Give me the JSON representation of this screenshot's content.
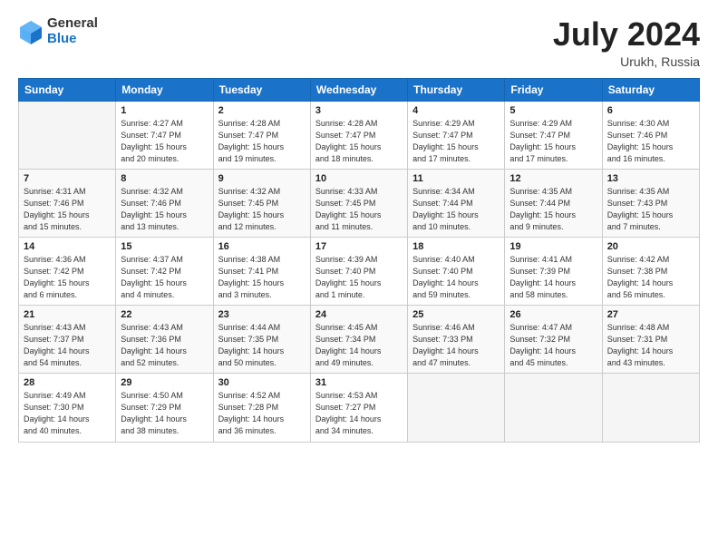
{
  "header": {
    "logo_general": "General",
    "logo_blue": "Blue",
    "month_year": "July 2024",
    "location": "Urukh, Russia"
  },
  "days_of_week": [
    "Sunday",
    "Monday",
    "Tuesday",
    "Wednesday",
    "Thursday",
    "Friday",
    "Saturday"
  ],
  "weeks": [
    [
      {
        "day": "",
        "detail": ""
      },
      {
        "day": "1",
        "detail": "Sunrise: 4:27 AM\nSunset: 7:47 PM\nDaylight: 15 hours\nand 20 minutes."
      },
      {
        "day": "2",
        "detail": "Sunrise: 4:28 AM\nSunset: 7:47 PM\nDaylight: 15 hours\nand 19 minutes."
      },
      {
        "day": "3",
        "detail": "Sunrise: 4:28 AM\nSunset: 7:47 PM\nDaylight: 15 hours\nand 18 minutes."
      },
      {
        "day": "4",
        "detail": "Sunrise: 4:29 AM\nSunset: 7:47 PM\nDaylight: 15 hours\nand 17 minutes."
      },
      {
        "day": "5",
        "detail": "Sunrise: 4:29 AM\nSunset: 7:47 PM\nDaylight: 15 hours\nand 17 minutes."
      },
      {
        "day": "6",
        "detail": "Sunrise: 4:30 AM\nSunset: 7:46 PM\nDaylight: 15 hours\nand 16 minutes."
      }
    ],
    [
      {
        "day": "7",
        "detail": "Sunrise: 4:31 AM\nSunset: 7:46 PM\nDaylight: 15 hours\nand 15 minutes."
      },
      {
        "day": "8",
        "detail": "Sunrise: 4:32 AM\nSunset: 7:46 PM\nDaylight: 15 hours\nand 13 minutes."
      },
      {
        "day": "9",
        "detail": "Sunrise: 4:32 AM\nSunset: 7:45 PM\nDaylight: 15 hours\nand 12 minutes."
      },
      {
        "day": "10",
        "detail": "Sunrise: 4:33 AM\nSunset: 7:45 PM\nDaylight: 15 hours\nand 11 minutes."
      },
      {
        "day": "11",
        "detail": "Sunrise: 4:34 AM\nSunset: 7:44 PM\nDaylight: 15 hours\nand 10 minutes."
      },
      {
        "day": "12",
        "detail": "Sunrise: 4:35 AM\nSunset: 7:44 PM\nDaylight: 15 hours\nand 9 minutes."
      },
      {
        "day": "13",
        "detail": "Sunrise: 4:35 AM\nSunset: 7:43 PM\nDaylight: 15 hours\nand 7 minutes."
      }
    ],
    [
      {
        "day": "14",
        "detail": "Sunrise: 4:36 AM\nSunset: 7:42 PM\nDaylight: 15 hours\nand 6 minutes."
      },
      {
        "day": "15",
        "detail": "Sunrise: 4:37 AM\nSunset: 7:42 PM\nDaylight: 15 hours\nand 4 minutes."
      },
      {
        "day": "16",
        "detail": "Sunrise: 4:38 AM\nSunset: 7:41 PM\nDaylight: 15 hours\nand 3 minutes."
      },
      {
        "day": "17",
        "detail": "Sunrise: 4:39 AM\nSunset: 7:40 PM\nDaylight: 15 hours\nand 1 minute."
      },
      {
        "day": "18",
        "detail": "Sunrise: 4:40 AM\nSunset: 7:40 PM\nDaylight: 14 hours\nand 59 minutes."
      },
      {
        "day": "19",
        "detail": "Sunrise: 4:41 AM\nSunset: 7:39 PM\nDaylight: 14 hours\nand 58 minutes."
      },
      {
        "day": "20",
        "detail": "Sunrise: 4:42 AM\nSunset: 7:38 PM\nDaylight: 14 hours\nand 56 minutes."
      }
    ],
    [
      {
        "day": "21",
        "detail": "Sunrise: 4:43 AM\nSunset: 7:37 PM\nDaylight: 14 hours\nand 54 minutes."
      },
      {
        "day": "22",
        "detail": "Sunrise: 4:43 AM\nSunset: 7:36 PM\nDaylight: 14 hours\nand 52 minutes."
      },
      {
        "day": "23",
        "detail": "Sunrise: 4:44 AM\nSunset: 7:35 PM\nDaylight: 14 hours\nand 50 minutes."
      },
      {
        "day": "24",
        "detail": "Sunrise: 4:45 AM\nSunset: 7:34 PM\nDaylight: 14 hours\nand 49 minutes."
      },
      {
        "day": "25",
        "detail": "Sunrise: 4:46 AM\nSunset: 7:33 PM\nDaylight: 14 hours\nand 47 minutes."
      },
      {
        "day": "26",
        "detail": "Sunrise: 4:47 AM\nSunset: 7:32 PM\nDaylight: 14 hours\nand 45 minutes."
      },
      {
        "day": "27",
        "detail": "Sunrise: 4:48 AM\nSunset: 7:31 PM\nDaylight: 14 hours\nand 43 minutes."
      }
    ],
    [
      {
        "day": "28",
        "detail": "Sunrise: 4:49 AM\nSunset: 7:30 PM\nDaylight: 14 hours\nand 40 minutes."
      },
      {
        "day": "29",
        "detail": "Sunrise: 4:50 AM\nSunset: 7:29 PM\nDaylight: 14 hours\nand 38 minutes."
      },
      {
        "day": "30",
        "detail": "Sunrise: 4:52 AM\nSunset: 7:28 PM\nDaylight: 14 hours\nand 36 minutes."
      },
      {
        "day": "31",
        "detail": "Sunrise: 4:53 AM\nSunset: 7:27 PM\nDaylight: 14 hours\nand 34 minutes."
      },
      {
        "day": "",
        "detail": ""
      },
      {
        "day": "",
        "detail": ""
      },
      {
        "day": "",
        "detail": ""
      }
    ]
  ]
}
